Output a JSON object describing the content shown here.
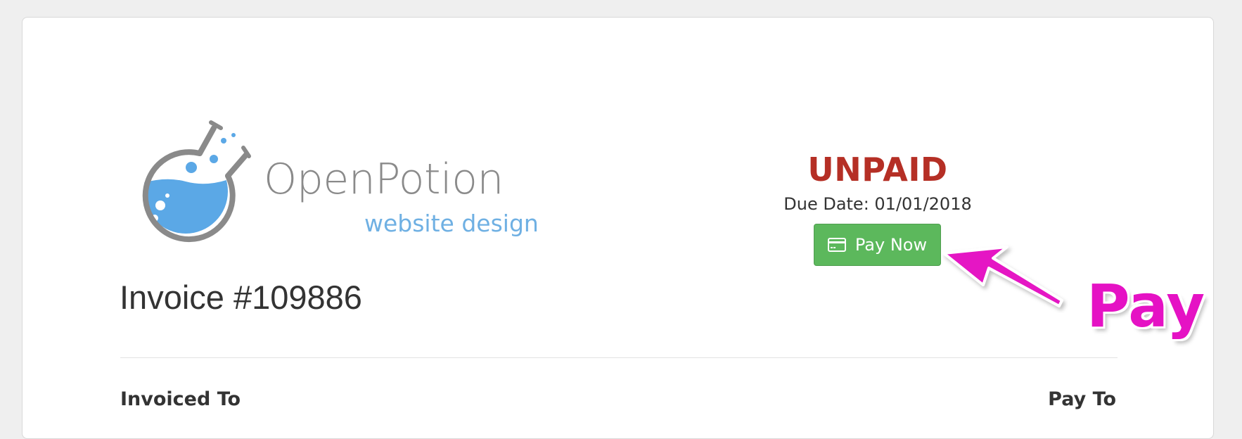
{
  "logo": {
    "name": "OpenPotion",
    "tagline": "website design",
    "colors": {
      "flask_outline": "#8a8a8a",
      "liquid": "#5ba8e6",
      "tagline": "#6fb0e3"
    }
  },
  "invoice": {
    "title": "Invoice #109886",
    "status": "UNPAID",
    "status_color": "#b52f25",
    "due_date_text": "Due Date: 01/01/2018"
  },
  "pay_button": {
    "label": "Pay Now",
    "icon": "credit-card-icon",
    "color": "#5cb85c"
  },
  "sections": {
    "invoiced_to": "Invoiced To",
    "pay_to": "Pay To"
  },
  "annotation": {
    "text": "Pay",
    "color": "#e512c4",
    "icon": "arrow-pointer-icon"
  }
}
